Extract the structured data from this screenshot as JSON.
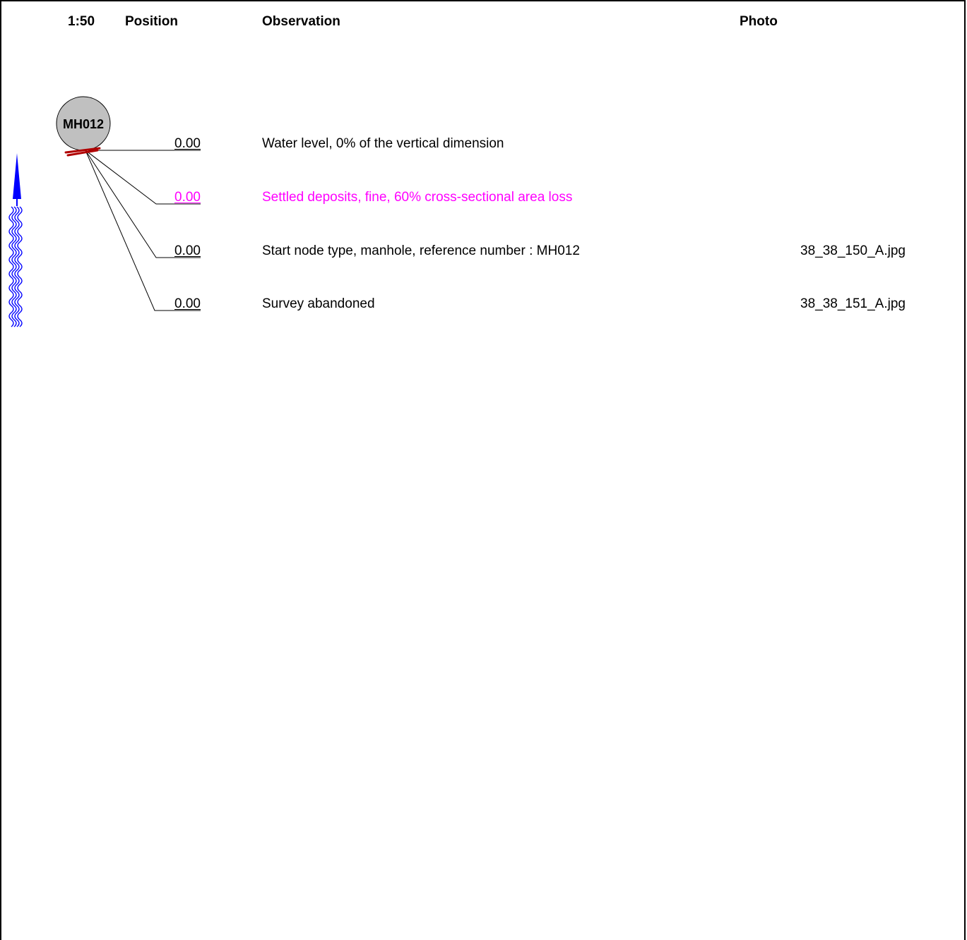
{
  "header": {
    "scale": "1:50",
    "position": "Position",
    "observation": "Observation",
    "photo": "Photo"
  },
  "node": {
    "label": "MH012",
    "fill_color": "#c0c0c0"
  },
  "observations": [
    {
      "position": "0.00",
      "text": "Water level, 0% of the vertical dimension",
      "photo": "",
      "color": "#000000"
    },
    {
      "position": "0.00",
      "text": "Settled deposits, fine, 60% cross-sectional area loss",
      "photo": "",
      "color": "#ff00ff"
    },
    {
      "position": "0.00",
      "text": "Start node type, manhole, reference number : MH012",
      "photo": "38_38_150_A.jpg",
      "color": "#000000"
    },
    {
      "position": "0.00",
      "text": "Survey abandoned",
      "photo": "38_38_151_A.jpg",
      "color": "#000000"
    }
  ],
  "icons": {
    "flow_direction": "flow-direction-arrow-icon",
    "water": "water-waves-icon",
    "deposit_mark": "deposit-mark-icon"
  },
  "colors": {
    "flow_arrow": "#0000ff",
    "deposit_mark": "#b00000"
  }
}
